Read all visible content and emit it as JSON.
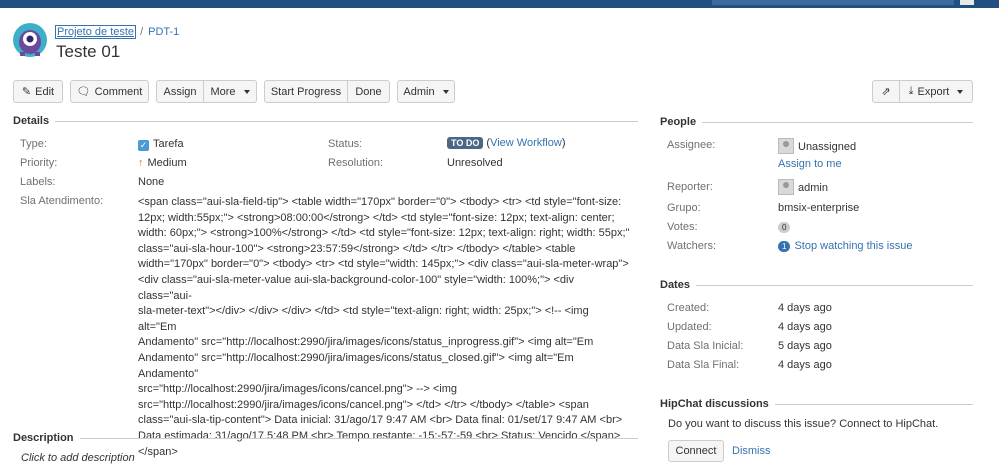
{
  "breadcrumbs": {
    "project": "Projeto de teste",
    "separator": "/",
    "issue_key": "PDT-1"
  },
  "issue": {
    "title": "Teste 01"
  },
  "toolbar": {
    "edit": "Edit",
    "comment": "Comment",
    "assign": "Assign",
    "more": "More",
    "start_progress": "Start Progress",
    "done": "Done",
    "admin": "Admin",
    "export": "Export"
  },
  "details": {
    "heading": "Details",
    "type_label": "Type:",
    "type_value": "Tarefa",
    "priority_label": "Priority:",
    "priority_value": "Medium",
    "labels_label": "Labels:",
    "labels_value": "None",
    "sla_label": "Sla Atendimento:",
    "sla_value": "<span class=\"aui-sla-field-tip\"> <table width=\"170px\" border=\"0\"> <tbody> <tr> <td style=\"font-size:\n12px; width:55px;\"> <strong>08:00:00</strong> </td> <td style=\"font-size: 12px; text-align: center;\nwidth: 60px;\"> <strong>100%</strong> </td> <td style=\"font-size: 12px; text-align: right; width: 55px;\"\nclass=\"aui-sla-hour-100\"> <strong>23:57:59</strong> </td> </tr> </tbody> </table> <table\nwidth=\"170px\" border=\"0\"> <tbody> <tr> <td style=\"width: 145px;\"> <div class=\"aui-sla-meter-wrap\">\n<div class=\"aui-sla-meter-value aui-sla-background-color-100\" style=\"width: 100%;\"> <div class=\"aui-\nsla-meter-text\"></div> </div> </div> </td> <td style=\"text-align: right; width: 25px;\"> <!-- <img alt=\"Em\nAndamento\" src=\"http://localhost:2990/jira/images/icons/status_inprogress.gif\"> <img alt=\"Em\nAndamento\" src=\"http://localhost:2990/jira/images/icons/status_closed.gif\"> <img alt=\"Em Andamento\"\nsrc=\"http://localhost:2990/jira/images/icons/cancel.png\"> --> <img\nsrc=\"http://localhost:2990/jira/images/icons/cancel.png\"> </td> </tr> </tbody> </table> <span\nclass=\"aui-sla-tip-content\"> Data inicial: 31/ago/17 9:47 AM <br> Data final: 01/set/17 9:47 AM <br>\nData estimada: 31/ago/17 5:48 PM <br> Tempo restante: -15:-57:-59 <br> Status: Vencido </span>\n</span>",
    "status_label": "Status:",
    "status_value": "TO DO",
    "view_workflow": "View Workflow",
    "resolution_label": "Resolution:",
    "resolution_value": "Unresolved"
  },
  "description": {
    "heading": "Description",
    "placeholder": "Click to add description"
  },
  "people": {
    "heading": "People",
    "assignee_label": "Assignee:",
    "assignee_value": "Unassigned",
    "assign_to_me": "Assign to me",
    "reporter_label": "Reporter:",
    "reporter_value": "admin",
    "grupo_label": "Grupo:",
    "grupo_value": "bmsix-enterprise",
    "votes_label": "Votes:",
    "votes_value": "0",
    "watchers_label": "Watchers:",
    "watchers_count": "1",
    "watchers_link": "Stop watching this issue"
  },
  "dates": {
    "heading": "Dates",
    "created_label": "Created:",
    "created_value": "4 days ago",
    "updated_label": "Updated:",
    "updated_value": "4 days ago",
    "sla_inicial_label": "Data Sla Inicial:",
    "sla_inicial_value": "5 days ago",
    "sla_final_label": "Data Sla Final:",
    "sla_final_value": "4 days ago"
  },
  "hipchat": {
    "heading": "HipChat discussions",
    "prompt": "Do you want to discuss this issue? Connect to HipChat.",
    "connect": "Connect",
    "dismiss": "Dismiss"
  },
  "colors": {
    "link": "#3572b0",
    "header_bar": "#205081",
    "status_lozenge": "#4a6785"
  }
}
